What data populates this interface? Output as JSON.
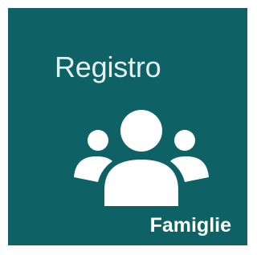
{
  "tile": {
    "title": "Registro",
    "subtitle": "Famiglie",
    "icon": "users-group-icon",
    "background_color": "#0e6266",
    "text_color": "#ffffff"
  }
}
